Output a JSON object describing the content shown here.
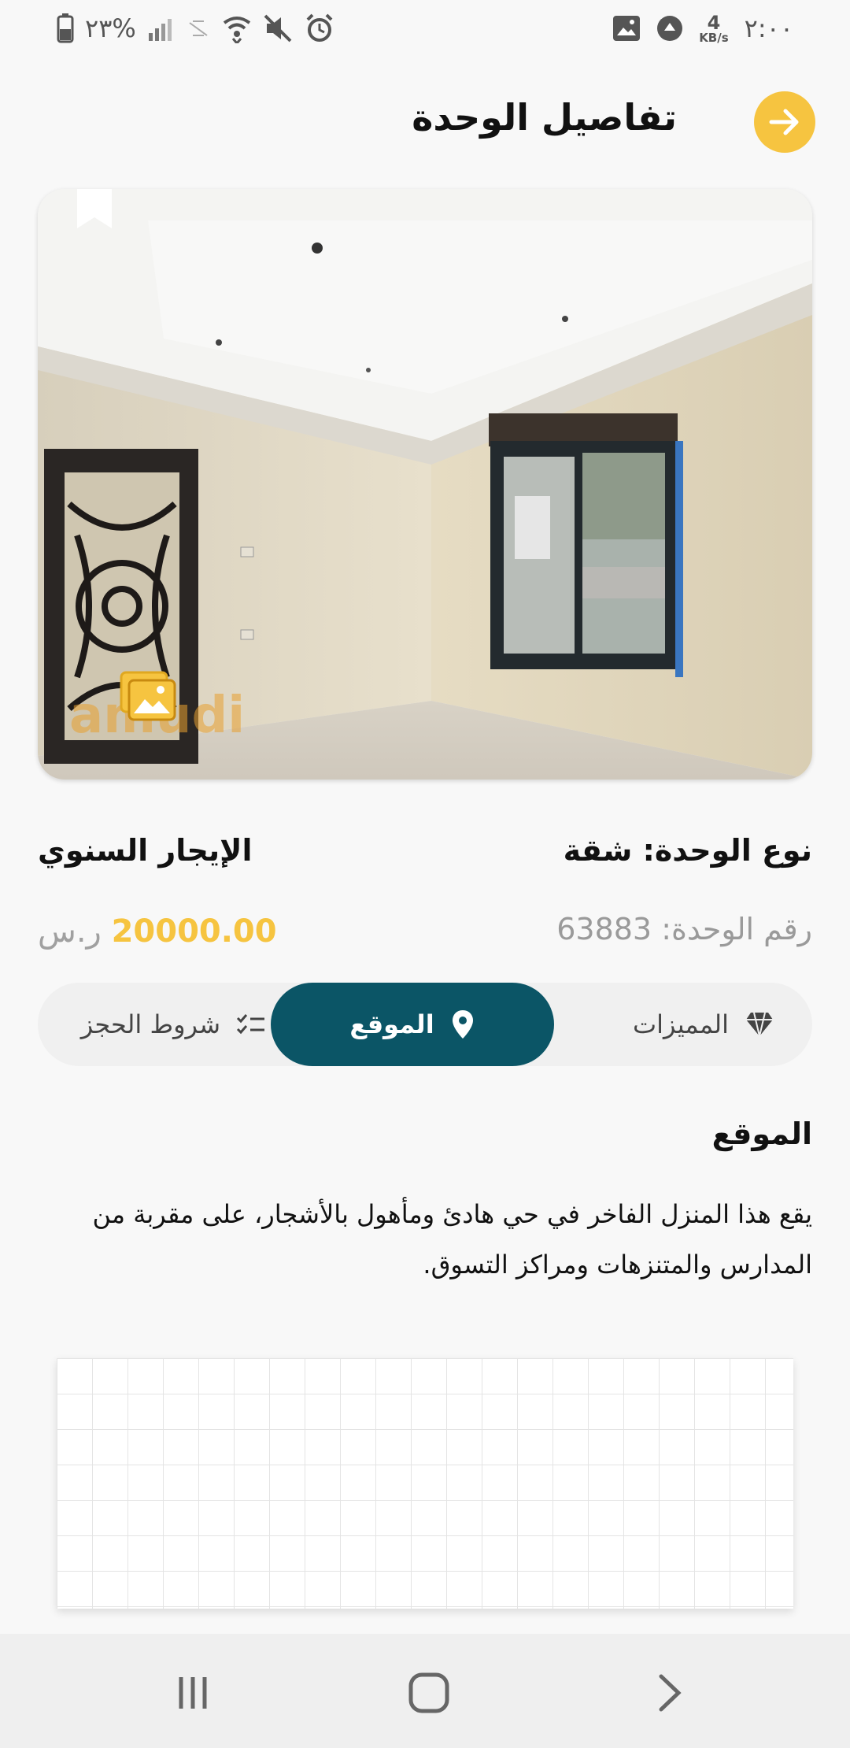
{
  "status_bar": {
    "time": "٢:٠٠",
    "battery": "٢٣%",
    "net_speed_value": "4",
    "net_speed_unit": "KB/s"
  },
  "header": {
    "title": "تفاصيل الوحدة",
    "back_icon": "arrow-right-icon"
  },
  "unit": {
    "type_label": "نوع الوحدة: شقة",
    "rent_type": "الإيجار السنوي",
    "number_label": "رقم الوحدة: 63883",
    "price": "20000.00",
    "currency": "ر.س"
  },
  "tabs": [
    {
      "label": "المميزات",
      "icon": "diamond-icon"
    },
    {
      "label": "الموقع",
      "icon": "location-pin-icon"
    },
    {
      "label": "شروط الحجز",
      "icon": "checklist-icon"
    }
  ],
  "location": {
    "title": "الموقع",
    "description": "يقع هذا المنزل الفاخر في حي هادئ ومأهول بالأشجار، على مقربة من المدارس والمتنزهات ومراكز التسوق."
  },
  "colors": {
    "accent_yellow": "#f6c440",
    "primary_teal": "#0b5566"
  }
}
